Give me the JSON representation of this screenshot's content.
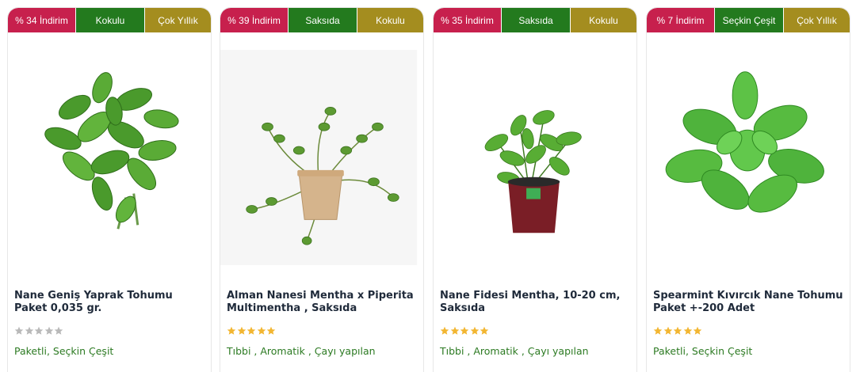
{
  "colors": {
    "discount_badge": "#c7204d",
    "green_badge": "#237a1e",
    "gold_badge": "#a48d1f",
    "star_filled": "#f2b632",
    "star_empty": "#b9b9b9",
    "tag_text": "#2c7a22",
    "title_text": "#1f2a3a"
  },
  "products": [
    {
      "badges": [
        "% 34 İndirim",
        "Kokulu",
        "Çok Yıllık"
      ],
      "image_icon": "mint-bunch-image",
      "title": "Nane Geniş Yaprak Tohumu Paket 0,035 gr.",
      "rating_stars": 0,
      "tags": "Paketli, Seçkin Çeşit"
    },
    {
      "badges": [
        "% 39 İndirim",
        "Saksıda",
        "Kokulu"
      ],
      "image_icon": "potted-mint-image",
      "title": "Alman Nanesi Mentha x Piperita Multimentha , Saksıda",
      "rating_stars": 5,
      "tags": "Tıbbi , Aromatik , Çayı yapılan"
    },
    {
      "badges": [
        "% 35 İndirim",
        "Saksıda",
        "Kokulu"
      ],
      "image_icon": "mint-seedling-pot-image",
      "title": "Nane Fidesi Mentha, 10-20 cm, Saksıda",
      "rating_stars": 5,
      "tags": "Tıbbi , Aromatik , Çayı yapılan"
    },
    {
      "badges": [
        "% 7 İndirim",
        "Seçkin Çeşit",
        "Çok Yıllık"
      ],
      "image_icon": "spearmint-sprig-image",
      "title": "Spearmint Kıvırcık Nane Tohumu Paket +-200 Adet",
      "rating_stars": 5,
      "tags": "Paketli, Seçkin Çeşit"
    }
  ]
}
